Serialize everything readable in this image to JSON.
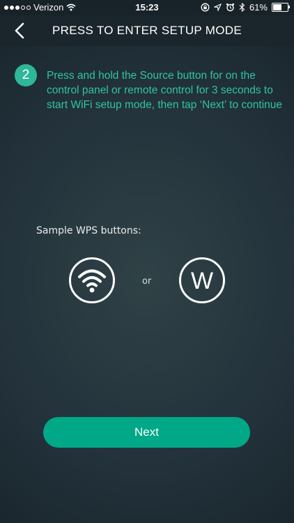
{
  "status_bar": {
    "carrier": "Verizon",
    "time": "15:23",
    "battery_percent": "61%",
    "battery_level": 0.61
  },
  "nav": {
    "title": "PRESS TO ENTER SETUP MODE",
    "back_icon": "chevron-left-icon"
  },
  "step": {
    "number": "2",
    "text": "Press and hold the Source button for on the control panel or remote control for 3 seconds to start WiFi setup mode, then tap ‘Next’ to continue"
  },
  "wps": {
    "label": "Sample WPS buttons:",
    "or_text": "or",
    "w_letter": "W"
  },
  "next_button": {
    "label": "Next"
  },
  "colors": {
    "accent": "#2fb79a",
    "button": "#00a887",
    "step_text": "#30c3a3"
  }
}
